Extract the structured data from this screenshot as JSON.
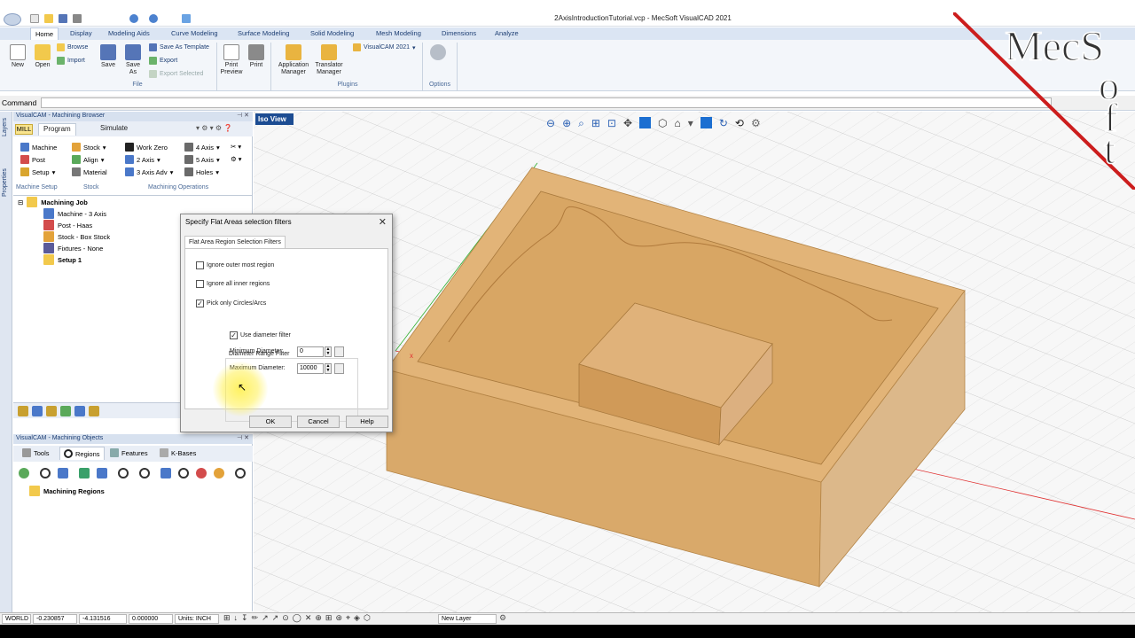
{
  "window": {
    "title": "2AxisIntroductionTutorial.vcp - MecSoft VisualCAD 2021"
  },
  "tabs": [
    "Home",
    "Display",
    "Modeling Aids",
    "Curve Modeling",
    "Surface Modeling",
    "Solid Modeling",
    "Mesh Modeling",
    "Dimensions",
    "Analyze"
  ],
  "ribbon": {
    "new": "New",
    "open": "Open",
    "browse": "Browse",
    "import": "Import",
    "save": "Save",
    "save_as": "Save As",
    "save_as_template": "Save As Template",
    "export": "Export",
    "export_selected": "Export Selected",
    "print_preview": "Print Preview",
    "print": "Print",
    "application_manager": "Application Manager",
    "translator_manager": "Translator Manager",
    "visualcam": "VisualCAM 2021",
    "group_file": "File",
    "group_plugins": "Plugins",
    "group_options": "Options"
  },
  "command": {
    "label": "Command"
  },
  "side_strip": {
    "layers": "Layers",
    "properties": "Properties"
  },
  "machining_browser": {
    "title": "VisualCAM - Machining Browser",
    "mill": "MILL",
    "tab_program": "Program",
    "tab_simulate": "Simulate",
    "machine": "Machine",
    "post": "Post",
    "setup": "Setup",
    "stock": "Stock",
    "align": "Align",
    "material": "Material",
    "work_zero": "Work Zero",
    "two_axis": "2 Axis",
    "three_axis_adv": "3 Axis Adv",
    "four_axis": "4 Axis",
    "five_axis": "5 Axis",
    "holes": "Holes",
    "group_machine_setup": "Machine Setup",
    "group_stock": "Stock",
    "group_machining_ops": "Machining Operations",
    "tree": {
      "root": "Machining Job",
      "machine": "Machine - 3 Axis",
      "post": "Post - Haas",
      "stock": "Stock - Box Stock",
      "fixtures": "Fixtures - None",
      "setup": "Setup 1"
    }
  },
  "machining_objects": {
    "title": "VisualCAM - Machining Objects",
    "tab_tools": "Tools",
    "tab_regions": "Regions",
    "tab_features": "Features",
    "tab_kbases": "K-Bases",
    "tree_root": "Machining Regions"
  },
  "viewport": {
    "view_label": "Iso View"
  },
  "dialog": {
    "title": "Specify Flat Areas selection filters",
    "tab": "Flat Area Region Selection Filters",
    "ignore_outer": "Ignore outer most region",
    "ignore_inner": "Ignore all inner regions",
    "pick_circles": "Pick only Circles/Arcs",
    "group_label": "Diameter Range Filter",
    "use_diameter": "Use diameter filter",
    "min_label": "Minimum Diameter:",
    "min_value": "0",
    "max_label": "Maximum Diameter:",
    "max_value": "10000",
    "ok": "OK",
    "cancel": "Cancel",
    "help": "Help",
    "checks": {
      "ignore_outer": false,
      "ignore_inner": false,
      "pick_circles": true,
      "use_diameter": true
    }
  },
  "status": {
    "world": "WORLD",
    "x": "-0.230857",
    "y": "-4.131516",
    "z": "0.000000",
    "units": "Units: INCH",
    "layer": "New Layer"
  },
  "logo": {
    "text_line1": "MecS",
    "text_col": [
      "o",
      "f",
      "t"
    ]
  },
  "colors": {
    "part": "#d9a96a",
    "accent": "#1c6fd1",
    "highlight": "#fff050"
  }
}
